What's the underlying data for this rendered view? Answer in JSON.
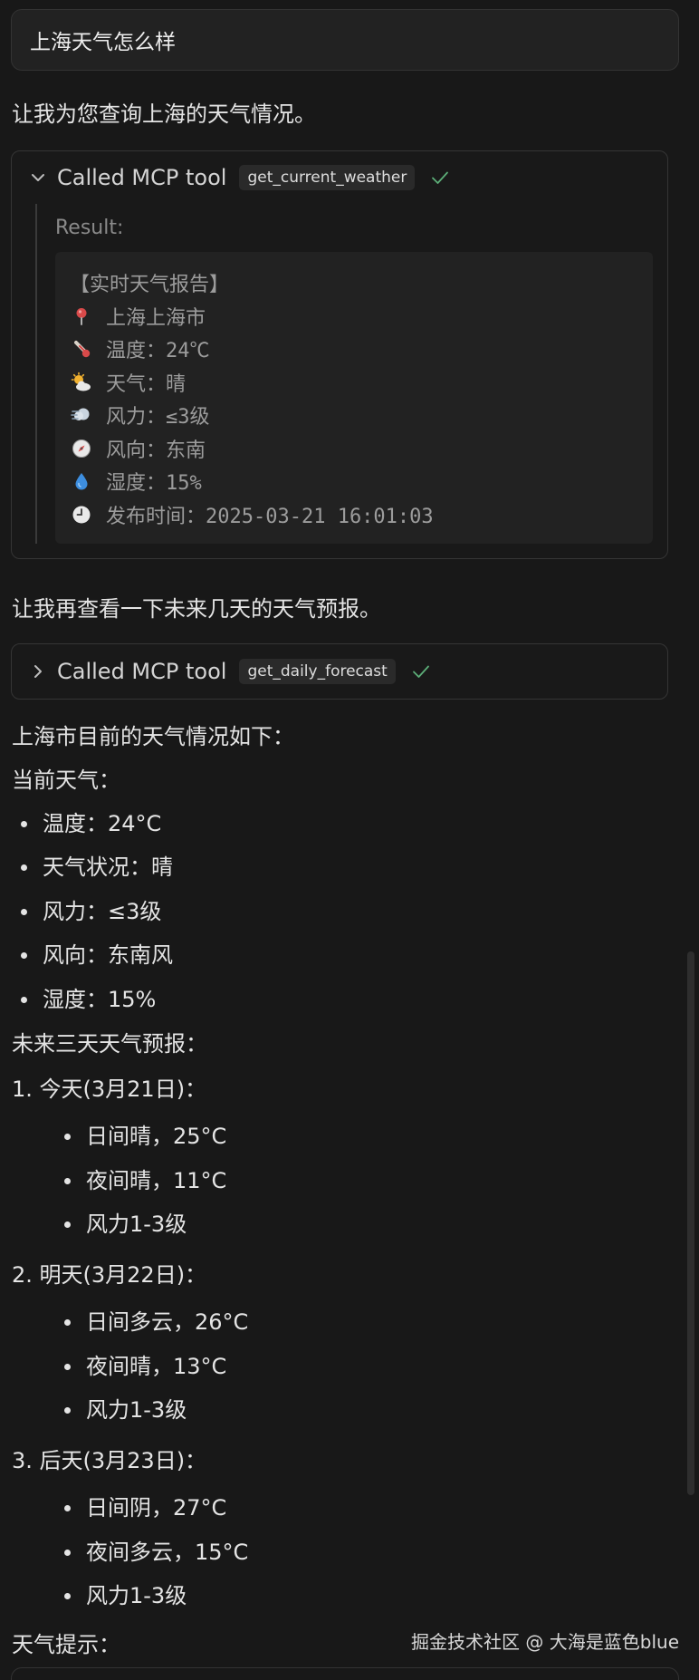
{
  "user_message": "上海天气怎么样",
  "assistant": {
    "intro": "让我为您查询上海的天气情况。",
    "tool_call_1": {
      "prefix": "Called MCP tool",
      "name": "get_current_weather",
      "expanded": true,
      "result_label": "Result:",
      "result_title": "【实时天气报告】",
      "result_rows": [
        {
          "icon": "pin-icon",
          "text": "上海上海市"
        },
        {
          "icon": "thermometer-icon",
          "text": "温度：24℃"
        },
        {
          "icon": "sun-cloud-icon",
          "text": "天气：晴"
        },
        {
          "icon": "wind-icon",
          "text": "风力：≤3级"
        },
        {
          "icon": "compass-icon",
          "text": "风向：东南"
        },
        {
          "icon": "droplet-icon",
          "text": "湿度：15%"
        },
        {
          "icon": "clock-icon",
          "text": "发布时间：2025-03-21 16:01:03"
        }
      ]
    },
    "followup": "让我再查看一下未来几天的天气预报。",
    "tool_call_2": {
      "prefix": "Called MCP tool",
      "name": "get_daily_forecast",
      "expanded": false
    },
    "summary_intro": "上海市目前的天气情况如下：",
    "current_heading": "当前天气：",
    "current_items": [
      "温度：24°C",
      "天气状况：晴",
      "风力：≤3级",
      "风向：东南风",
      "湿度：15%"
    ],
    "forecast_heading": "未来三天天气预报：",
    "forecast_days": [
      {
        "title": "1. 今天(3月21日)：",
        "items": [
          "日间晴，25°C",
          "夜间晴，11°C",
          "风力1-3级"
        ]
      },
      {
        "title": "2. 明天(3月22日)：",
        "items": [
          "日间多云，26°C",
          "夜间晴，13°C",
          "风力1-3级"
        ]
      },
      {
        "title": "3. 后天(3月23日)：",
        "items": [
          "日间阴，27°C",
          "夜间多云，15°C",
          "风力1-3级"
        ]
      }
    ],
    "tips_heading": "天气提示："
  },
  "watermark": "掘金技术社区 @ 大海是蓝色blue",
  "colors": {
    "background": "#181818",
    "success_check": "#5cae78"
  }
}
